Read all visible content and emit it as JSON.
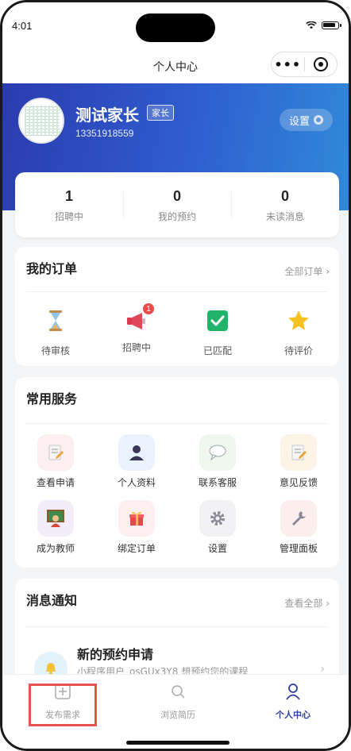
{
  "status_bar": {
    "time": "4:01"
  },
  "nav": {
    "title": "个人中心",
    "menu_dots": "•••"
  },
  "profile": {
    "name": "测试家长",
    "role": "家长",
    "phone": "13351918559",
    "settings_label": "设置"
  },
  "stats": [
    {
      "value": "1",
      "label": "招聘中"
    },
    {
      "value": "0",
      "label": "我的预约"
    },
    {
      "value": "0",
      "label": "未读消息"
    }
  ],
  "orders": {
    "title": "我的订单",
    "more": "全部订单 ›",
    "items": [
      {
        "label": "待审核",
        "icon": "hourglass-icon"
      },
      {
        "label": "招聘中",
        "icon": "megaphone-icon",
        "badge": "1"
      },
      {
        "label": "已匹配",
        "icon": "check-square-icon"
      },
      {
        "label": "待评价",
        "icon": "star-icon"
      }
    ]
  },
  "services": {
    "title": "常用服务",
    "items": [
      {
        "label": "查看申请",
        "icon": "memo-icon",
        "bg": "#fdeef0"
      },
      {
        "label": "个人资料",
        "icon": "user-icon",
        "bg": "#e8f3fd"
      },
      {
        "label": "联系客服",
        "icon": "chat-bubble-icon",
        "bg": "#eef8ec"
      },
      {
        "label": "意见反馈",
        "icon": "memo-icon",
        "bg": "#fdf3e6"
      },
      {
        "label": "成为教师",
        "icon": "teacher-icon",
        "bg": "#f3ecfb"
      },
      {
        "label": "绑定订单",
        "icon": "gift-icon",
        "bg": "#fdeef0"
      },
      {
        "label": "设置",
        "icon": "gear-icon",
        "bg": "#f1f1f3"
      },
      {
        "label": "管理面板",
        "icon": "wrench-icon",
        "bg": "#fdeeee"
      }
    ]
  },
  "messages": {
    "title": "消息通知",
    "more": "查看全部 ›",
    "items": [
      {
        "title": "新的预约申请",
        "text": "小程序用户_osGUx3Y8 想预约您的课程",
        "icon": "bell-icon"
      }
    ]
  },
  "tabbar": {
    "items": [
      {
        "label": "发布需求",
        "icon": "plus-square-icon"
      },
      {
        "label": "浏览简历",
        "icon": "search-icon"
      },
      {
        "label": "个人中心",
        "icon": "person-icon"
      }
    ],
    "active_index": 2
  },
  "colors": {
    "accent": "#2e3aa6",
    "gradient_start": "#2b3bb0",
    "gradient_end": "#2f8ad8",
    "highlight": "#e55252"
  }
}
